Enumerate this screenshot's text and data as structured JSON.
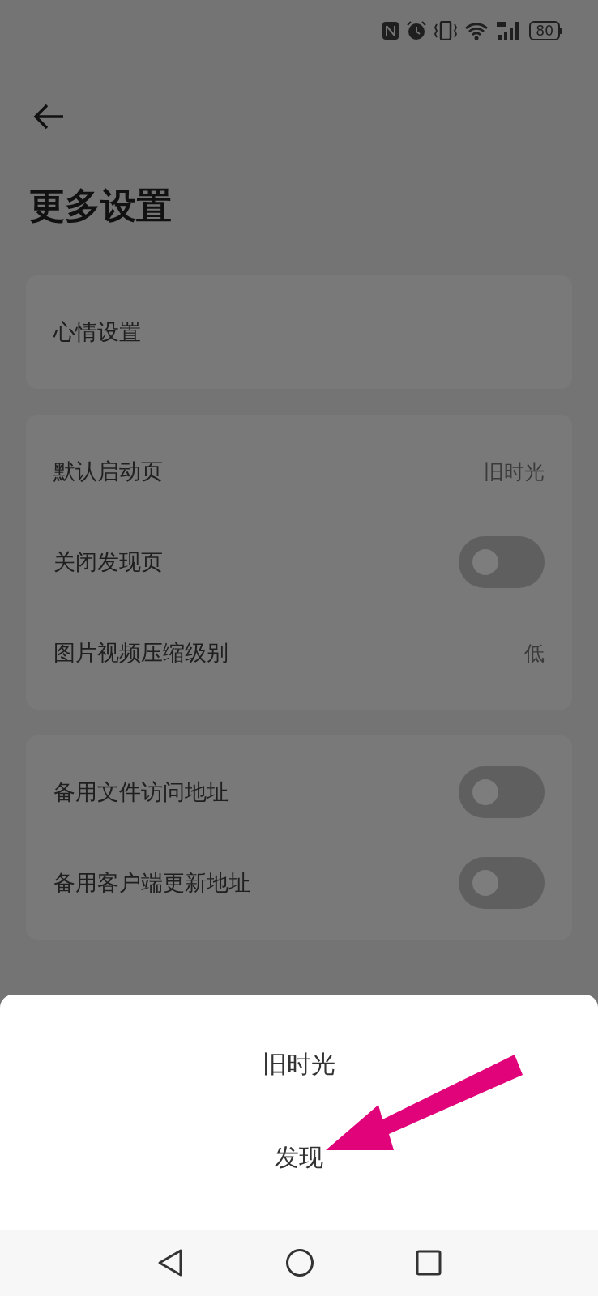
{
  "status_bar": {
    "battery": "80"
  },
  "header": {
    "title": "更多设置"
  },
  "groups": [
    {
      "rows": [
        {
          "kind": "nav",
          "label": "心情设置"
        }
      ]
    },
    {
      "rows": [
        {
          "kind": "value",
          "label": "默认启动页",
          "value": "旧时光"
        },
        {
          "kind": "switch",
          "label": "关闭发现页",
          "on": false
        },
        {
          "kind": "value",
          "label": "图片视频压缩级别",
          "value": "低"
        }
      ]
    },
    {
      "rows": [
        {
          "kind": "switch",
          "label": "备用文件访问地址",
          "on": false
        },
        {
          "kind": "switch",
          "label": "备用客户端更新地址",
          "on": false
        }
      ]
    }
  ],
  "sheet": {
    "options": [
      {
        "label": "旧时光"
      },
      {
        "label": "发现"
      }
    ]
  }
}
